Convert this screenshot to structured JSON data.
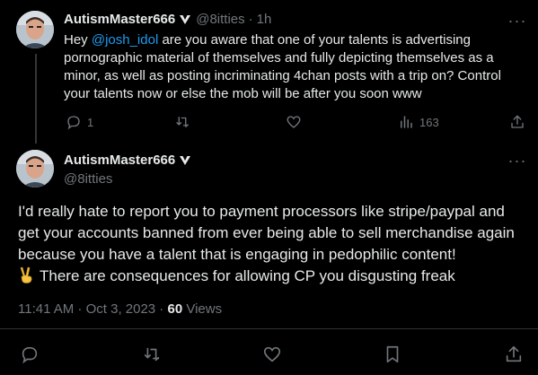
{
  "reply_tweet": {
    "display_name": "AutismMaster666",
    "handle": "@8itties",
    "separator": "·",
    "time": "1h",
    "text_prefix": "Hey ",
    "mention": "@josh_idol",
    "text_suffix": " are you aware that one of your talents is advertising pornographic material of themselves and fully depicting themselves as a minor, as well as posting incriminating 4chan posts with a trip on? Control your talents now or else the mob will be after you soon www",
    "reply_count": "1",
    "repost_count": "",
    "like_count": "",
    "view_count": "163"
  },
  "main_tweet": {
    "display_name": "AutismMaster666",
    "handle": "@8itties",
    "text_main": "I'd really hate to report you to payment processors like stripe/paypal and get your accounts banned from ever being able to sell merchandise again because you have a talent that is engaging in pedophilic content!",
    "text_tail": "There are consequences for allowing CP you disgusting freak",
    "timestamp": "11:41 AM · Oct 3, 2023 · ",
    "views_count": "60",
    "views_label": " Views"
  },
  "icons": {
    "verified": "verified-badge-icon",
    "more": "more-icon",
    "reply": "reply-icon",
    "repost": "repost-icon",
    "like": "heart-icon",
    "views": "views-icon",
    "share": "share-icon",
    "emoji": "victory-hand-emoji"
  },
  "colors": {
    "background": "#000000",
    "text": "#e7e9ea",
    "muted": "#71767b",
    "accent": "#1d9bf0",
    "divider": "#2f3336"
  }
}
